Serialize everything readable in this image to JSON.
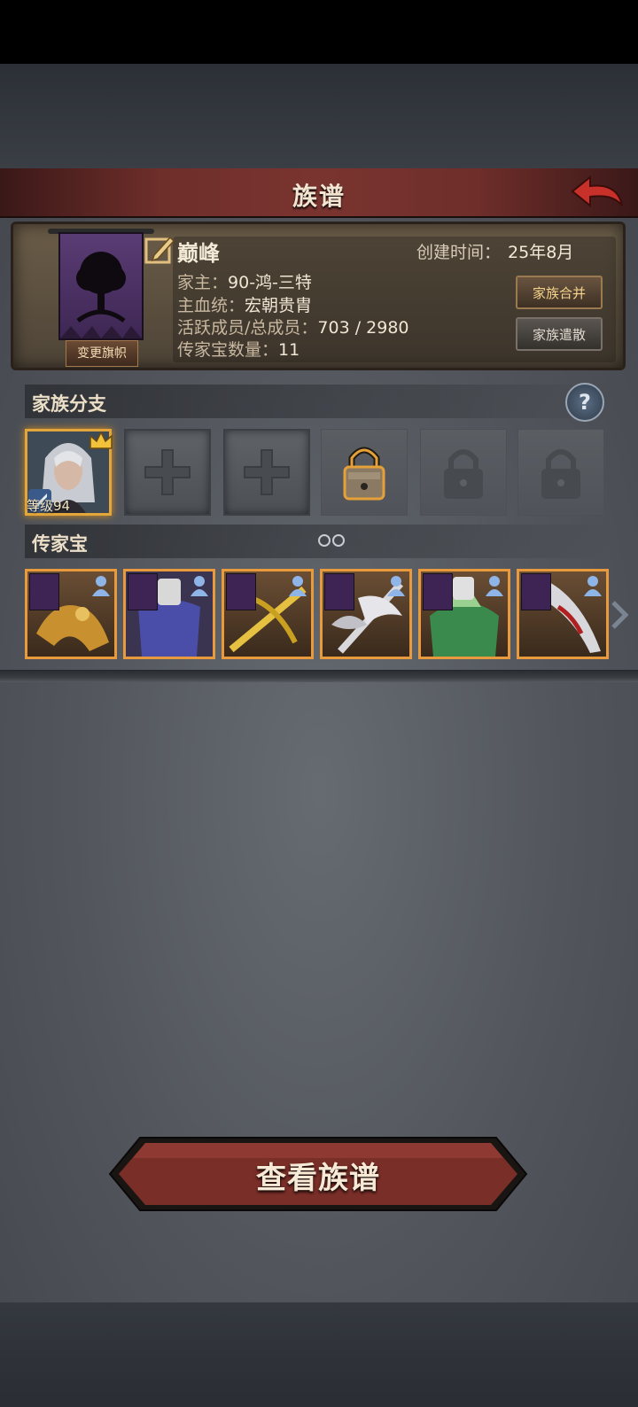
{
  "header": {
    "title": "族谱"
  },
  "family": {
    "name": "巅峰",
    "created_label": "创建时间：",
    "created_value": "25年8月",
    "leader_label": "家主：",
    "leader_value": "90-鸿-三特",
    "bloodline_label": "主血统：",
    "bloodline_value": "宏朝贵胄",
    "members_label": "活跃成员/总成员：",
    "members_value": "703 / 2980",
    "heirloom_count_label": "传家宝数量：",
    "heirloom_count_value": "11",
    "change_flag_label": "变更旗帜",
    "merge_label": "家族合并",
    "dissolve_label": "家族遣散"
  },
  "branches": {
    "title": "家族分支",
    "help": "?",
    "member": {
      "level_text": "等级94"
    },
    "slots": [
      "member",
      "empty",
      "empty",
      "lock-gold",
      "lock",
      "lock"
    ]
  },
  "heirlooms": {
    "title": "传家宝",
    "items": [
      "dragon-staff",
      "armor",
      "golden-crossbow",
      "silver-halberd",
      "emerald-armor",
      "crimson-blade"
    ]
  },
  "footer": {
    "view_button_label": "查看族谱"
  },
  "colors": {
    "accent_gold": "#e89a3c",
    "title_red": "#6e2e2a",
    "banner_purple": "#4a2c62"
  }
}
